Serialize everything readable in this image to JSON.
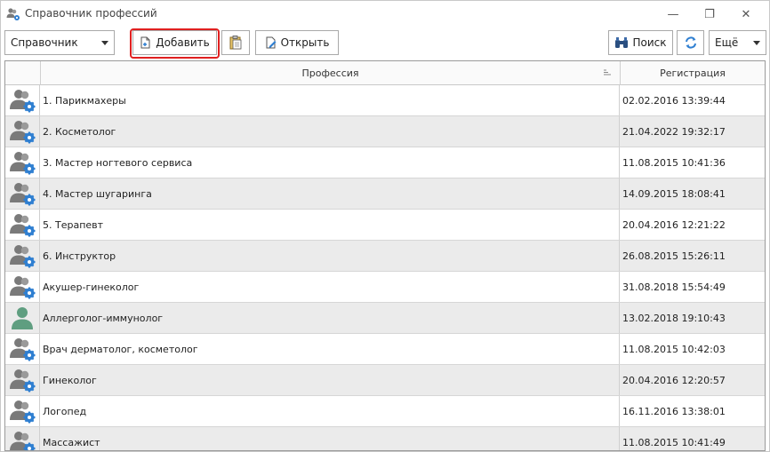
{
  "window": {
    "title": "Справочник профессий",
    "controls": {
      "minimize": "—",
      "maximize": "❐",
      "close": "✕"
    }
  },
  "toolbar": {
    "combo_value": "Справочник",
    "add_label": "Добавить",
    "open_label": "Открыть",
    "search_label": "Поиск",
    "more_label": "Ещё"
  },
  "grid": {
    "columns": {
      "profession": "Профессия",
      "registration": "Регистрация"
    },
    "rows": [
      {
        "name": "1. Парикмахеры",
        "date": "02.02.2016 13:39:44",
        "icon": "users-gear-icon"
      },
      {
        "name": "2. Косметолог",
        "date": "21.04.2022 19:32:17",
        "icon": "users-gear-icon"
      },
      {
        "name": "3. Мастер ногтевого сервиса",
        "date": "11.08.2015 10:41:36",
        "icon": "users-gear-icon"
      },
      {
        "name": "4. Мастер шугаринга",
        "date": "14.09.2015 18:08:41",
        "icon": "users-gear-icon"
      },
      {
        "name": "5. Терапевт",
        "date": "20.04.2016 12:21:22",
        "icon": "users-gear-icon"
      },
      {
        "name": "6. Инструктор",
        "date": "26.08.2015 15:26:11",
        "icon": "users-gear-icon"
      },
      {
        "name": "Акушер-гинеколог",
        "date": "31.08.2018 15:54:49",
        "icon": "users-gear-icon"
      },
      {
        "name": "Аллерголог-иммунолог",
        "date": "13.02.2018 19:10:43",
        "icon": "user-green-icon"
      },
      {
        "name": "Врач дерматолог, косметолог",
        "date": "11.08.2015 10:42:03",
        "icon": "users-gear-icon"
      },
      {
        "name": "Гинеколог",
        "date": "20.04.2016 12:20:57",
        "icon": "users-gear-icon"
      },
      {
        "name": "Логопед",
        "date": "16.11.2016 13:38:01",
        "icon": "users-gear-icon"
      },
      {
        "name": "Массажист",
        "date": "11.08.2015 10:41:49",
        "icon": "users-gear-icon"
      }
    ]
  },
  "colors": {
    "highlight": "#e02020",
    "row_alt": "#ebebeb",
    "gear_blue": "#2f7fd1",
    "user_gray": "#7a7a7a",
    "user_green": "#5f9e80"
  }
}
